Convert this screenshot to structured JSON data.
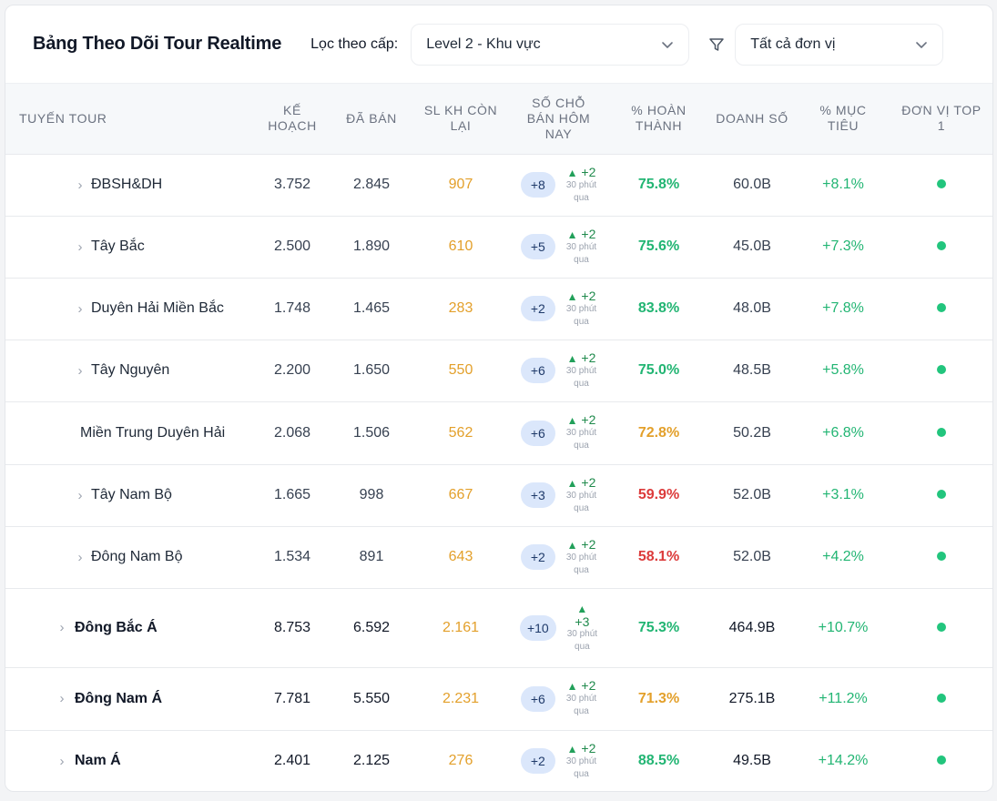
{
  "header": {
    "title": "Bảng Theo Dõi Tour Realtime",
    "filter_label": "Lọc theo cấp:",
    "level_select": "Level 2 - Khu vực",
    "unit_select": "Tất cả đơn vị"
  },
  "columns": {
    "route": "TUYẾN TOUR",
    "plan_1": "KẾ",
    "plan_2": "HOẠCH",
    "sold": "ĐÃ BÁN",
    "remain_1": "SL KH CÒN",
    "remain_2": "LẠI",
    "today_1": "SỐ CHỖ",
    "today_2": "BÁN HÔM",
    "today_3": "NAY",
    "pct_1": "% HOÀN",
    "pct_2": "THÀNH",
    "revenue": "DOANH SỐ",
    "target_1": "% MỤC",
    "target_2": "TIÊU",
    "top_1": "ĐƠN VỊ TOP",
    "top_2": "1"
  },
  "rows": [
    {
      "route": "ĐBSH&DH",
      "plan": "3.752",
      "sold": "2.845",
      "remain": "907",
      "today": "+8",
      "delta": "+2",
      "delta_sub_1": "30 phút",
      "delta_sub_2": "qua",
      "pct": "75.8%",
      "revenue": "60.0B",
      "target": "+8.1%"
    },
    {
      "route": "Tây Bắc",
      "plan": "2.500",
      "sold": "1.890",
      "remain": "610",
      "today": "+5",
      "delta": "+2",
      "delta_sub_1": "30 phút",
      "delta_sub_2": "qua",
      "pct": "75.6%",
      "revenue": "45.0B",
      "target": "+7.3%"
    },
    {
      "route": "Duyên Hải Miền Bắc",
      "plan": "1.748",
      "sold": "1.465",
      "remain": "283",
      "today": "+2",
      "delta": "+2",
      "delta_sub_1": "30 phút",
      "delta_sub_2": "qua",
      "pct": "83.8%",
      "revenue": "48.0B",
      "target": "+7.8%"
    },
    {
      "route": "Tây Nguyên",
      "plan": "2.200",
      "sold": "1.650",
      "remain": "550",
      "today": "+6",
      "delta": "+2",
      "delta_sub_1": "30 phút",
      "delta_sub_2": "qua",
      "pct": "75.0%",
      "revenue": "48.5B",
      "target": "+5.8%"
    },
    {
      "route": "Miền Trung Duyên Hải",
      "plan": "2.068",
      "sold": "1.506",
      "remain": "562",
      "today": "+6",
      "delta": "+2",
      "delta_sub_1": "30 phút",
      "delta_sub_2": "qua",
      "pct": "72.8%",
      "revenue": "50.2B",
      "target": "+6.8%"
    },
    {
      "route": "Tây Nam Bộ",
      "plan": "1.665",
      "sold": "998",
      "remain": "667",
      "today": "+3",
      "delta": "+2",
      "delta_sub_1": "30 phút",
      "delta_sub_2": "qua",
      "pct": "59.9%",
      "revenue": "52.0B",
      "target": "+3.1%"
    },
    {
      "route": "Đông Nam Bộ",
      "plan": "1.534",
      "sold": "891",
      "remain": "643",
      "today": "+2",
      "delta": "+2",
      "delta_sub_1": "30 phút",
      "delta_sub_2": "qua",
      "pct": "58.1%",
      "revenue": "52.0B",
      "target": "+4.2%"
    },
    {
      "route": "Đông Bắc Á",
      "plan": "8.753",
      "sold": "6.592",
      "remain": "2.161",
      "today": "+10",
      "delta": "+3",
      "delta_sub_1": "30 phút",
      "delta_sub_2": "qua",
      "pct": "75.3%",
      "revenue": "464.9B",
      "target": "+10.7%"
    },
    {
      "route": "Đông Nam Á",
      "plan": "7.781",
      "sold": "5.550",
      "remain": "2.231",
      "today": "+6",
      "delta": "+2",
      "delta_sub_1": "30 phút",
      "delta_sub_2": "qua",
      "pct": "71.3%",
      "revenue": "275.1B",
      "target": "+11.2%"
    },
    {
      "route": "Nam Á",
      "plan": "2.401",
      "sold": "2.125",
      "remain": "276",
      "today": "+2",
      "delta": "+2",
      "delta_sub_1": "30 phút",
      "delta_sub_2": "qua",
      "pct": "88.5%",
      "revenue": "49.5B",
      "target": "+14.2%"
    }
  ],
  "colors": {
    "amber": "#e3a02b",
    "green": "#22b573",
    "red": "#dc3b3b",
    "dot": "#22c57d",
    "pill_bg": "#dbe7fb"
  },
  "icons": {
    "expander": "chevron-right-icon",
    "select": "chevron-down-icon",
    "filter": "funnel-icon",
    "trend": "triangle-up-icon",
    "top_unit": "status-dot-icon"
  }
}
